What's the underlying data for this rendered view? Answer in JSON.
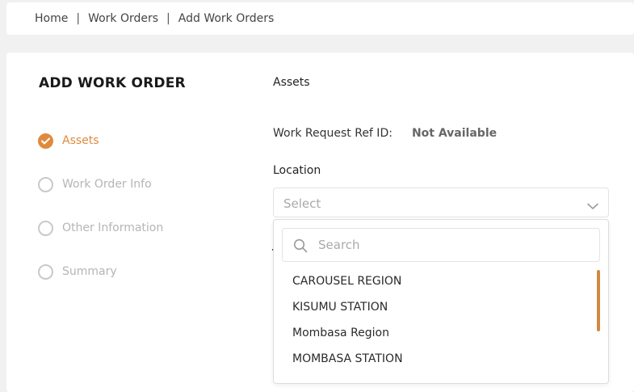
{
  "breadcrumb": {
    "items": [
      "Home",
      "Work Orders",
      "Add Work Orders"
    ],
    "separator": "|"
  },
  "page": {
    "title": "ADD WORK ORDER"
  },
  "steps": [
    {
      "label": "Assets",
      "state": "completed"
    },
    {
      "label": "Work Order Info",
      "state": "pending"
    },
    {
      "label": "Other Information",
      "state": "pending"
    },
    {
      "label": "Summary",
      "state": "pending"
    }
  ],
  "form": {
    "section_title": "Assets",
    "ref_label": "Work Request Ref ID:",
    "ref_value": "Not Available",
    "location_label": "Location",
    "location_placeholder": "Select"
  },
  "dropdown": {
    "search_placeholder": "Search",
    "options": [
      "CAROUSEL REGION",
      "KISUMU STATION",
      "Mombasa Region",
      "MOMBASA STATION"
    ]
  },
  "colors": {
    "accent": "#e08a3e",
    "inactive": "#c9c9c9",
    "background": "#f1f1f1"
  },
  "icons": {
    "step_completed": "check-circle-icon",
    "step_pending": "empty-circle-icon",
    "select": "chevron-down-icon",
    "search": "search-icon"
  }
}
